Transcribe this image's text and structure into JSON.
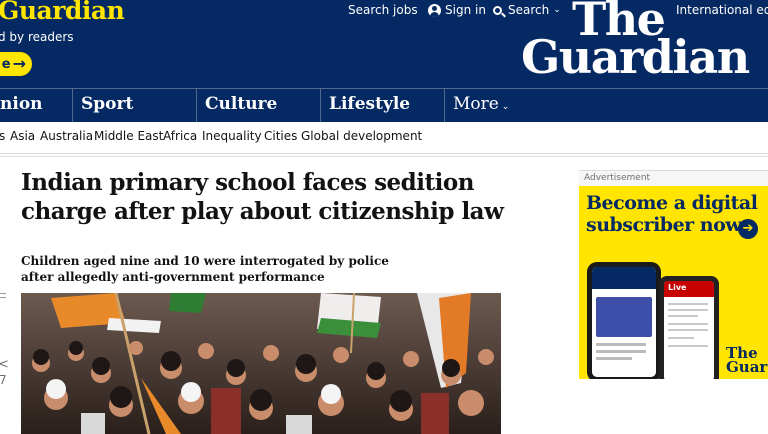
{
  "masthead": {
    "support_heading": "Guardian",
    "support_sub": "d by readers",
    "support_button": "e",
    "top_links": {
      "search_jobs": "Search jobs",
      "sign_in": "Sign in",
      "search": "Search",
      "edition": "International edi"
    },
    "logo": {
      "line1": "The",
      "line2": "Guardian"
    },
    "brand_color": "#052962",
    "accent_color": "#ffe500"
  },
  "pillars": [
    {
      "label": "nion"
    },
    {
      "label": "Sport"
    },
    {
      "label": "Culture"
    },
    {
      "label": "Lifestyle"
    },
    {
      "label": "More"
    }
  ],
  "subnav": [
    "s",
    "Asia",
    "Australia",
    "Middle East",
    "Africa",
    "Inequality",
    "Cities",
    "Global development"
  ],
  "article": {
    "headline": "Indian primary school faces sedition charge after play about citizenship law",
    "standfirst": "Children aged nine and 10 were interrogated by police after allegedly anti-government performance",
    "share_count": "7"
  },
  "advert": {
    "label": "Advertisement",
    "title_line1": "Become a digital",
    "title_line2": "subscriber now",
    "live_label": "Live",
    "logo_text_line1": "The",
    "logo_text_line2": "Guard"
  }
}
